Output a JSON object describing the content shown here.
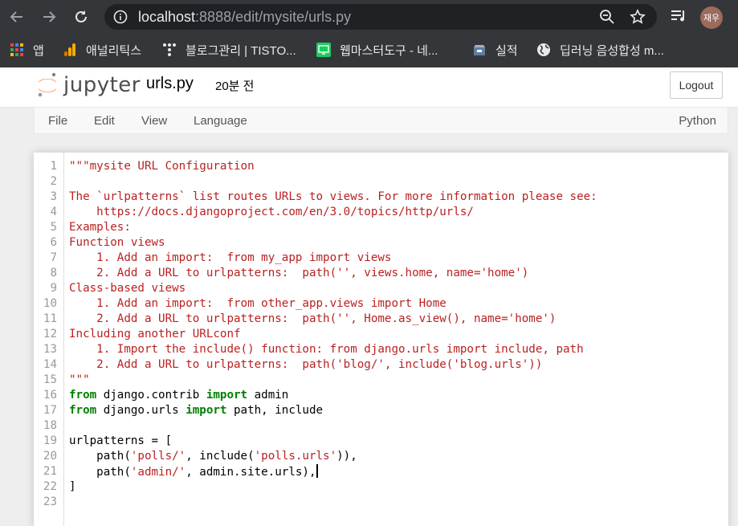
{
  "browser": {
    "url_host": "localhost",
    "url_rest": ":8888/edit/mysite/urls.py",
    "profile_initials": "재우",
    "bookmarks": [
      {
        "label": "앱",
        "icon": "apps-grid-icon"
      },
      {
        "label": "애널리틱스",
        "icon": "analytics-bar-icon"
      },
      {
        "label": "블로그관리 | TISTO...",
        "icon": "tistory-dots-icon"
      },
      {
        "label": "웹마스터도구 - 네...",
        "icon": "webmaster-monitor-icon"
      },
      {
        "label": "실적",
        "icon": "stats-box-icon"
      },
      {
        "label": "딥러닝 음성합성 m...",
        "icon": "globe-icon"
      }
    ]
  },
  "jupyter": {
    "logo_text": "jupyter",
    "filename": "urls.py",
    "saved_status": "20분 전",
    "logout_label": "Logout",
    "menu": [
      "File",
      "Edit",
      "View",
      "Language"
    ],
    "language": "Python"
  },
  "editor": {
    "lines": [
      {
        "n": "1",
        "tokens": [
          {
            "t": "\"\"\"mysite URL Configuration",
            "c": "str"
          }
        ]
      },
      {
        "n": "2",
        "tokens": []
      },
      {
        "n": "3",
        "tokens": [
          {
            "t": "The `urlpatterns` list routes URLs to views. For more information please see:",
            "c": "str"
          }
        ]
      },
      {
        "n": "4",
        "tokens": [
          {
            "t": "    https://docs.djangoproject.com/en/3.0/topics/http/urls/",
            "c": "str"
          }
        ]
      },
      {
        "n": "5",
        "tokens": [
          {
            "t": "Examples:",
            "c": "str"
          }
        ]
      },
      {
        "n": "6",
        "tokens": [
          {
            "t": "Function views",
            "c": "str"
          }
        ]
      },
      {
        "n": "7",
        "tokens": [
          {
            "t": "    1. Add an import:  from my_app import views",
            "c": "str"
          }
        ]
      },
      {
        "n": "8",
        "tokens": [
          {
            "t": "    2. Add a URL to urlpatterns:  path('', views.home, name='home')",
            "c": "str"
          }
        ]
      },
      {
        "n": "9",
        "tokens": [
          {
            "t": "Class-based views",
            "c": "str"
          }
        ]
      },
      {
        "n": "10",
        "tokens": [
          {
            "t": "    1. Add an import:  from other_app.views import Home",
            "c": "str"
          }
        ]
      },
      {
        "n": "11",
        "tokens": [
          {
            "t": "    2. Add a URL to urlpatterns:  path('', Home.as_view(), name='home')",
            "c": "str"
          }
        ]
      },
      {
        "n": "12",
        "tokens": [
          {
            "t": "Including another URLconf",
            "c": "str"
          }
        ]
      },
      {
        "n": "13",
        "tokens": [
          {
            "t": "    1. Import the include() function: from django.urls import include, path",
            "c": "str"
          }
        ]
      },
      {
        "n": "14",
        "tokens": [
          {
            "t": "    2. Add a URL to urlpatterns:  path('blog/', include('blog.urls'))",
            "c": "str"
          }
        ]
      },
      {
        "n": "15",
        "tokens": [
          {
            "t": "\"\"\"",
            "c": "str"
          }
        ]
      },
      {
        "n": "16",
        "tokens": [
          {
            "t": "from",
            "c": "kw"
          },
          {
            "t": " django.contrib ",
            "c": "plain"
          },
          {
            "t": "import",
            "c": "kw"
          },
          {
            "t": " admin",
            "c": "plain"
          }
        ]
      },
      {
        "n": "17",
        "tokens": [
          {
            "t": "from",
            "c": "kw"
          },
          {
            "t": " django.urls ",
            "c": "plain"
          },
          {
            "t": "import",
            "c": "kw"
          },
          {
            "t": " path, include",
            "c": "plain"
          }
        ]
      },
      {
        "n": "18",
        "tokens": []
      },
      {
        "n": "19",
        "tokens": [
          {
            "t": "urlpatterns = [",
            "c": "plain"
          }
        ]
      },
      {
        "n": "20",
        "tokens": [
          {
            "t": "    path(",
            "c": "plain"
          },
          {
            "t": "'polls/'",
            "c": "str"
          },
          {
            "t": ", include(",
            "c": "plain"
          },
          {
            "t": "'polls.urls'",
            "c": "str"
          },
          {
            "t": ")),",
            "c": "plain"
          }
        ]
      },
      {
        "n": "21",
        "tokens": [
          {
            "t": "    path(",
            "c": "plain"
          },
          {
            "t": "'admin/'",
            "c": "str"
          },
          {
            "t": ", admin.site.urls),",
            "c": "plain"
          },
          {
            "t": "",
            "c": "cursor"
          }
        ]
      },
      {
        "n": "22",
        "tokens": [
          {
            "t": "]",
            "c": "plain"
          }
        ]
      },
      {
        "n": "23",
        "tokens": []
      }
    ]
  }
}
